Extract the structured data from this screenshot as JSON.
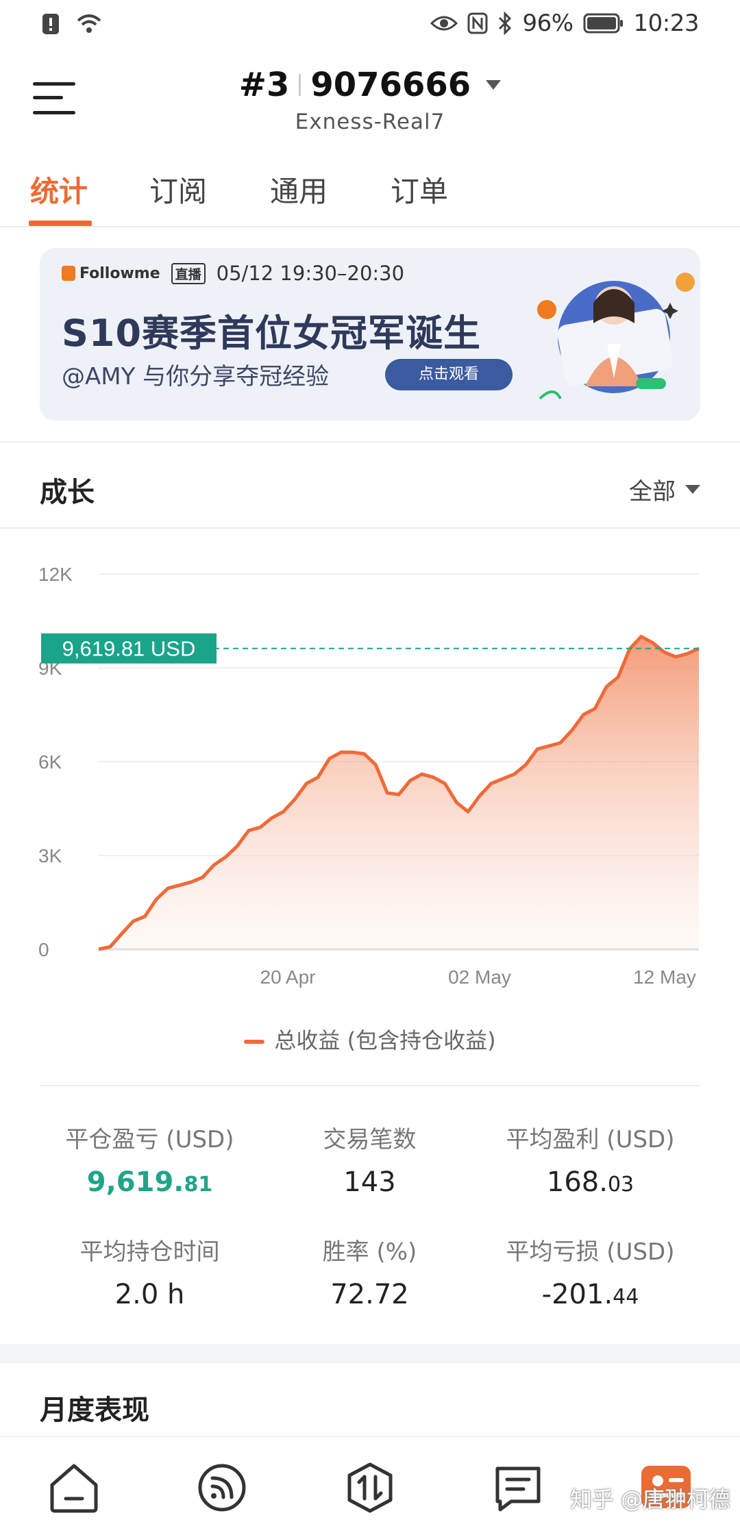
{
  "status_bar": {
    "battery": "96%",
    "time": "10:23"
  },
  "header": {
    "account_rank": "#3",
    "account_number": "9076666",
    "server": "Exness-Real7"
  },
  "tabs": [
    {
      "label": "统计",
      "active": true
    },
    {
      "label": "订阅",
      "active": false
    },
    {
      "label": "通用",
      "active": false
    },
    {
      "label": "订单",
      "active": false
    }
  ],
  "banner": {
    "brand": "Followme",
    "live_label": "直播",
    "schedule": "05/12  19:30–20:30",
    "title": "S10赛季首位女冠军诞生",
    "subtitle": "@AMY 与你分享夺冠经验",
    "cta": "点击观看"
  },
  "growth": {
    "title": "成长",
    "range_selector": "全部"
  },
  "chart_data": {
    "type": "area",
    "y_ticks": [
      "12K",
      "9K",
      "6K",
      "3K",
      "0"
    ],
    "x_ticks": [
      "20 Apr",
      "02 May",
      "12 May"
    ],
    "ylim": [
      0,
      12000
    ],
    "current_value_label": "9,619.81 USD",
    "current_value": 9619.81,
    "series": [
      {
        "name": "总收益 (包含持仓收益)",
        "color": "#ef6a3a",
        "values": [
          0,
          80,
          500,
          900,
          1050,
          1600,
          1950,
          2050,
          2150,
          2300,
          2700,
          2950,
          3300,
          3800,
          3900,
          4200,
          4400,
          4800,
          5300,
          5500,
          6100,
          6300,
          6300,
          6250,
          5900,
          5000,
          4950,
          5400,
          5600,
          5500,
          5300,
          4700,
          4400,
          4900,
          5300,
          5450,
          5600,
          5900,
          6400,
          6500,
          6600,
          7000,
          7500,
          7700,
          8400,
          8700,
          9600,
          10000,
          9800,
          9500,
          9350,
          9450,
          9620
        ]
      }
    ],
    "legend": [
      "总收益 (包含持仓收益)"
    ]
  },
  "stats": [
    {
      "label": "平仓盈亏 (USD)",
      "main": "9,619.",
      "small": "81",
      "highlight": true
    },
    {
      "label": "交易笔数",
      "main": "143",
      "small": "",
      "highlight": false
    },
    {
      "label": "平均盈利 (USD)",
      "main": "168.",
      "small": "03",
      "highlight": false
    },
    {
      "label": "平均持仓时间",
      "main": "2.0 h",
      "small": "",
      "highlight": false
    },
    {
      "label": "胜率 (%)",
      "main": "72.72",
      "small": "",
      "highlight": false
    },
    {
      "label": "平均亏损 (USD)",
      "main": "-201.",
      "small": "44",
      "highlight": false
    }
  ],
  "monthly_title": "月度表现",
  "bottom_nav": [
    {
      "icon": "home-icon"
    },
    {
      "icon": "feed-icon"
    },
    {
      "icon": "trade-icon"
    },
    {
      "icon": "message-icon"
    },
    {
      "icon": "profile-icon"
    }
  ],
  "watermark": "知乎 @唐翀柯德"
}
